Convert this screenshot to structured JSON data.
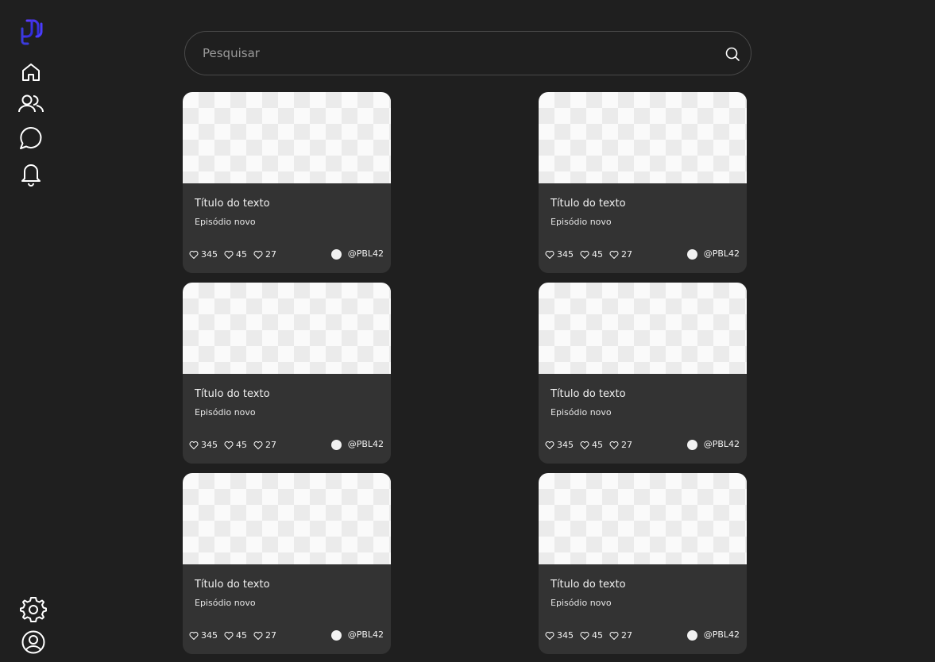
{
  "search": {
    "placeholder": "Pesquisar",
    "value": ""
  },
  "nav": {
    "top": [
      {
        "icon": "home-icon"
      },
      {
        "icon": "users-icon"
      },
      {
        "icon": "chat-icon"
      },
      {
        "icon": "bell-icon"
      }
    ],
    "bottom": [
      {
        "icon": "gear-icon"
      },
      {
        "icon": "user-circle-icon"
      }
    ]
  },
  "colors": {
    "background": "#1f1f1f",
    "card": "#333333",
    "logo_accent": "#3b3bdc"
  },
  "cards": [
    {
      "title": "Título do texto",
      "subtitle": "Episódio novo",
      "stats": [
        "345",
        "45",
        "27"
      ],
      "author": "@PBL42"
    },
    {
      "title": "Título do texto",
      "subtitle": "Episódio novo",
      "stats": [
        "345",
        "45",
        "27"
      ],
      "author": "@PBL42"
    },
    {
      "title": "Título do texto",
      "subtitle": "Episódio novo",
      "stats": [
        "345",
        "45",
        "27"
      ],
      "author": "@PBL42"
    },
    {
      "title": "Título do texto",
      "subtitle": "Episódio novo",
      "stats": [
        "345",
        "45",
        "27"
      ],
      "author": "@PBL42"
    },
    {
      "title": "Título do texto",
      "subtitle": "Episódio novo",
      "stats": [
        "345",
        "45",
        "27"
      ],
      "author": "@PBL42"
    },
    {
      "title": "Título do texto",
      "subtitle": "Episódio novo",
      "stats": [
        "345",
        "45",
        "27"
      ],
      "author": "@PBL42"
    }
  ]
}
